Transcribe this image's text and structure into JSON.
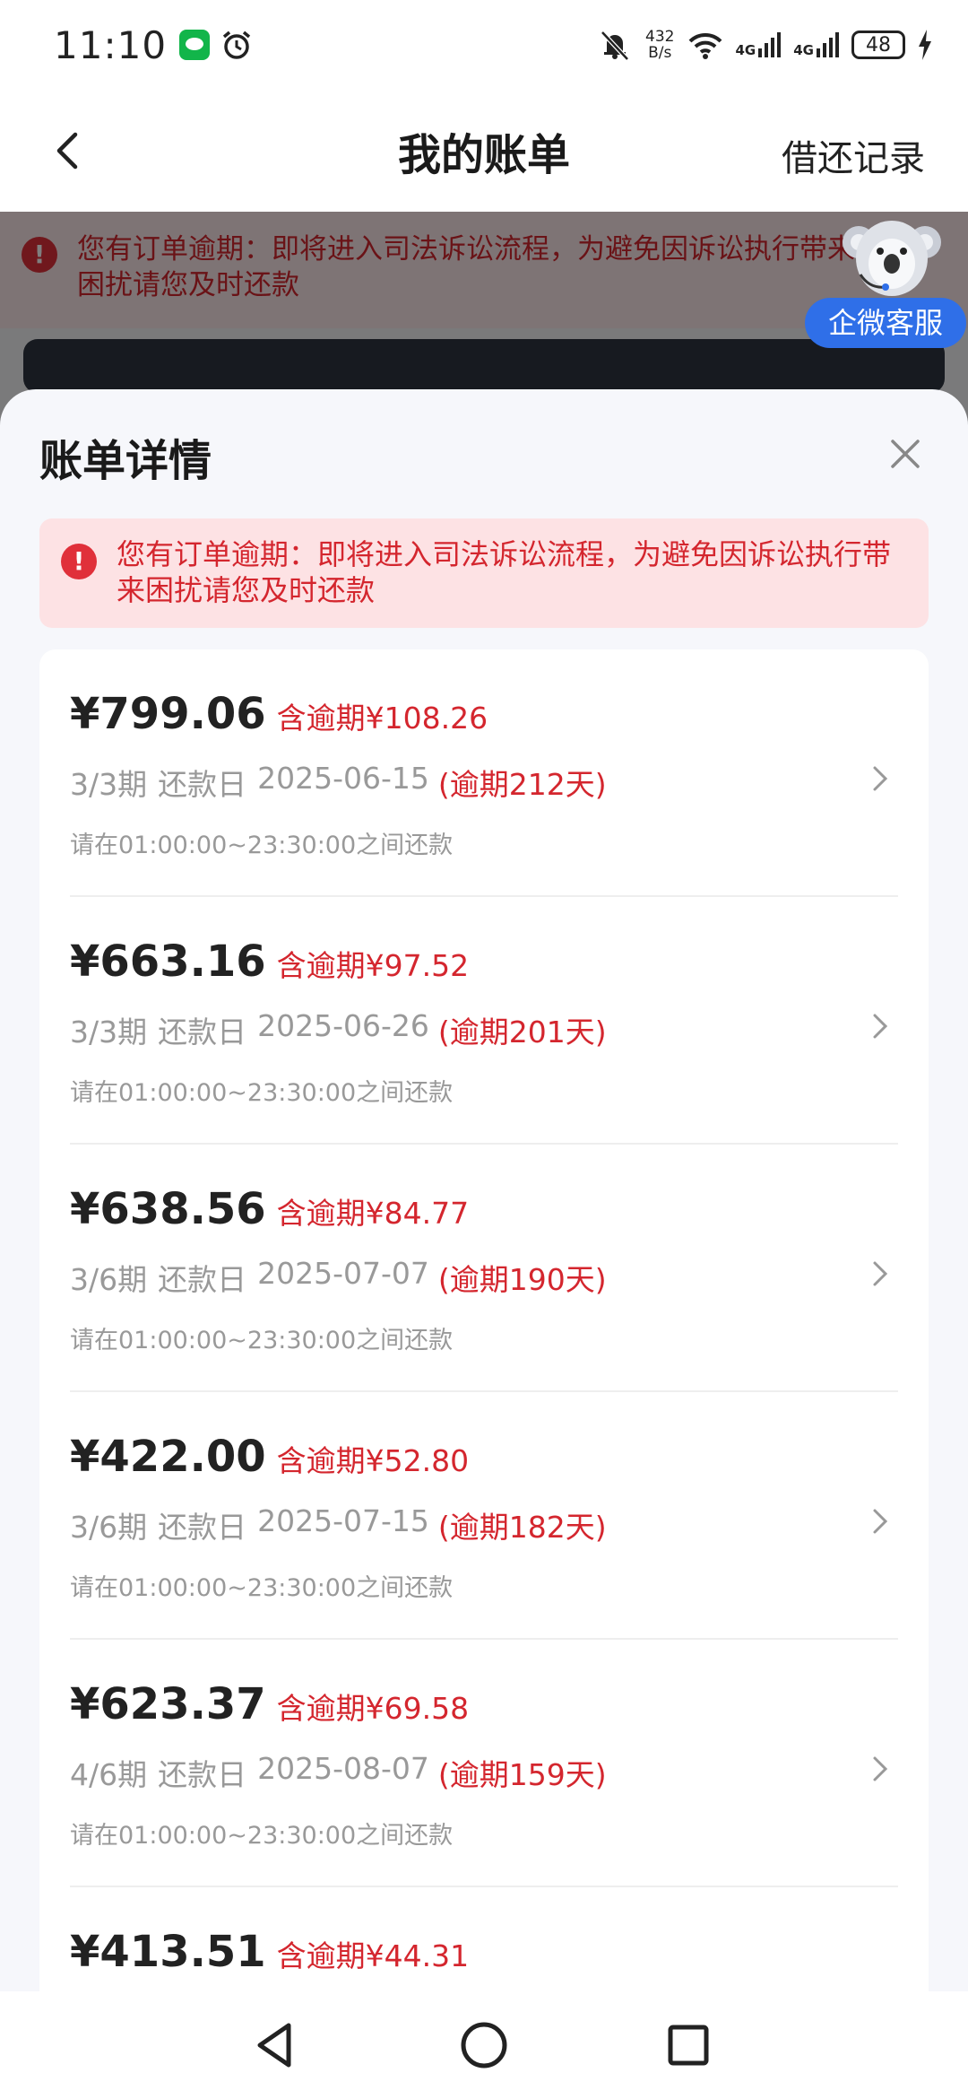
{
  "status_bar": {
    "time": "11:10",
    "net_speed_value": "432",
    "net_speed_unit": "B/s",
    "net1": "4G",
    "net2": "4G",
    "battery": "48"
  },
  "nav": {
    "title": "我的账单",
    "right_link": "借还记录"
  },
  "background": {
    "alert_text": "您有订单逾期：即将进入司法诉讼流程，为避免因诉讼执行带来困扰请您及时还款"
  },
  "service": {
    "label": "企微客服"
  },
  "sheet": {
    "title": "账单详情",
    "alert_text": "您有订单逾期：即将进入司法诉讼流程，为避免因诉讼执行带来困扰请您及时还款",
    "bills": [
      {
        "amount": "¥799.06",
        "overdue_amount": "含逾期¥108.26",
        "period": "3/3期",
        "due_label": "还款日",
        "due_date": "2025-06-15",
        "overdue_days": "(逾期212天)",
        "hint": "请在01:00:00~23:30:00之间还款"
      },
      {
        "amount": "¥663.16",
        "overdue_amount": "含逾期¥97.52",
        "period": "3/3期",
        "due_label": "还款日",
        "due_date": "2025-06-26",
        "overdue_days": "(逾期201天)",
        "hint": "请在01:00:00~23:30:00之间还款"
      },
      {
        "amount": "¥638.56",
        "overdue_amount": "含逾期¥84.77",
        "period": "3/6期",
        "due_label": "还款日",
        "due_date": "2025-07-07",
        "overdue_days": "(逾期190天)",
        "hint": "请在01:00:00~23:30:00之间还款"
      },
      {
        "amount": "¥422.00",
        "overdue_amount": "含逾期¥52.80",
        "period": "3/6期",
        "due_label": "还款日",
        "due_date": "2025-07-15",
        "overdue_days": "(逾期182天)",
        "hint": "请在01:00:00~23:30:00之间还款"
      },
      {
        "amount": "¥623.37",
        "overdue_amount": "含逾期¥69.58",
        "period": "4/6期",
        "due_label": "还款日",
        "due_date": "2025-08-07",
        "overdue_days": "(逾期159天)",
        "hint": "请在01:00:00~23:30:00之间还款"
      },
      {
        "amount": "¥413.51",
        "overdue_amount": "含逾期¥44.31"
      }
    ]
  },
  "colors": {
    "overdue_red": "#d4262e",
    "service_blue": "#2f6fe8",
    "alert_bg": "#fde2e4"
  }
}
